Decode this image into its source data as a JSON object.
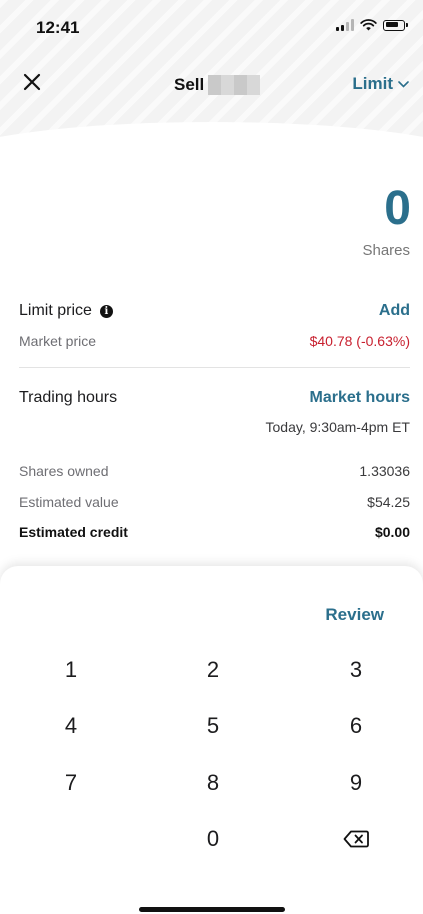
{
  "status_bar": {
    "time": "12:41"
  },
  "header": {
    "title": "Sell",
    "order_type": "Limit",
    "close_icon": "close-icon",
    "dropdown_icon": "chevron-down-icon"
  },
  "order": {
    "shares_value": "0",
    "shares_label": "Shares"
  },
  "limit_price": {
    "label": "Limit price",
    "action": "Add",
    "market_price_label": "Market price",
    "market_price_value": "$40.78 (-0.63%)"
  },
  "trading_hours": {
    "label": "Trading hours",
    "value": "Market hours",
    "detail": "Today, 9:30am-4pm ET"
  },
  "summary": {
    "shares_owned_label": "Shares owned",
    "shares_owned_value": "1.33036",
    "estimated_value_label": "Estimated value",
    "estimated_value_value": "$54.25",
    "estimated_credit_label": "Estimated credit",
    "estimated_credit_value": "$0.00"
  },
  "keypad": {
    "review_label": "Review",
    "keys": [
      "1",
      "2",
      "3",
      "4",
      "5",
      "6",
      "7",
      "8",
      "9",
      "0"
    ],
    "backspace_icon": "backspace-icon"
  },
  "colors": {
    "accent": "#2b6f8c",
    "negative": "#c8202f"
  }
}
